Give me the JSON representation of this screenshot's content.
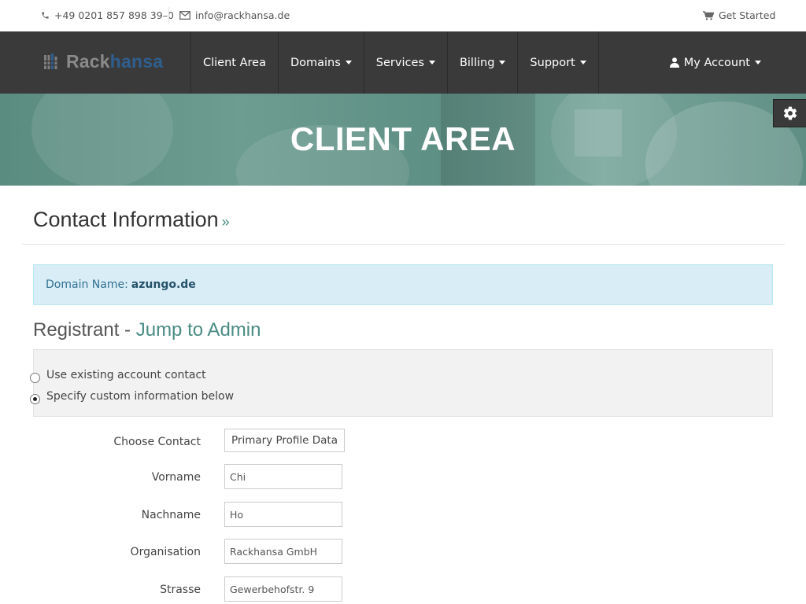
{
  "topbar": {
    "phone": "+49 0201 857 898 39–0",
    "email": "info@rackhansa.de",
    "get_started": "Get Started"
  },
  "brand": {
    "part1": "Rack",
    "part2": "hansa"
  },
  "nav": {
    "items": [
      {
        "label": "Client Area",
        "dropdown": false
      },
      {
        "label": "Domains",
        "dropdown": true
      },
      {
        "label": "Services",
        "dropdown": true
      },
      {
        "label": "Billing",
        "dropdown": true
      },
      {
        "label": "Support",
        "dropdown": true
      }
    ],
    "account": "My Account"
  },
  "hero": {
    "title": "CLIENT AREA"
  },
  "page": {
    "title": "Contact Information",
    "title_suffix": "»",
    "alert_label": "Domain Name:",
    "alert_value": "azungo.de",
    "section_title": "Registrant -",
    "section_link": "Jump to Admin"
  },
  "radio": {
    "existing": "Use existing account contact",
    "custom": "Specify custom information below"
  },
  "form": {
    "choose_contact_label": "Choose Contact",
    "choose_contact_value": "Primary Profile Data",
    "fields": [
      {
        "label": "Vorname",
        "value": "Chi"
      },
      {
        "label": "Nachname",
        "value": "Ho"
      },
      {
        "label": "Organisation",
        "value": "Rackhansa GmbH"
      },
      {
        "label": "Strasse",
        "value": "Gewerbehofstr. 9"
      }
    ]
  },
  "colors": {
    "navbar": "#3a3a3a",
    "accent": "#4a8c84",
    "brand_blue": "#2f5f8f",
    "alert_bg": "#d9edf7"
  },
  "icons": {
    "phone": "phone-icon",
    "email": "envelope-icon",
    "cart": "cart-icon",
    "user": "user-icon",
    "gear": "gear-icon",
    "logo": "server-bars-icon"
  }
}
